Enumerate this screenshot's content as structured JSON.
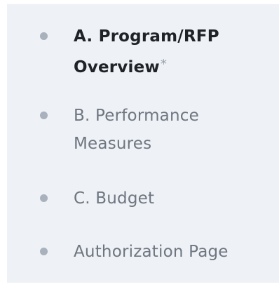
{
  "nav": {
    "items": [
      {
        "label": "A. Program/RFP Overview",
        "required_marker": "*",
        "active": true
      },
      {
        "label": "B. Performance Measures",
        "required_marker": "",
        "active": false
      },
      {
        "label": "C. Budget",
        "required_marker": "",
        "active": false
      },
      {
        "label": "Authorization Page",
        "required_marker": "",
        "active": false
      }
    ]
  },
  "colors": {
    "panel_background": "#eef1f6",
    "bullet": "#a9b1bc",
    "active_text": "#1f2328",
    "inactive_text": "#6e7680"
  }
}
